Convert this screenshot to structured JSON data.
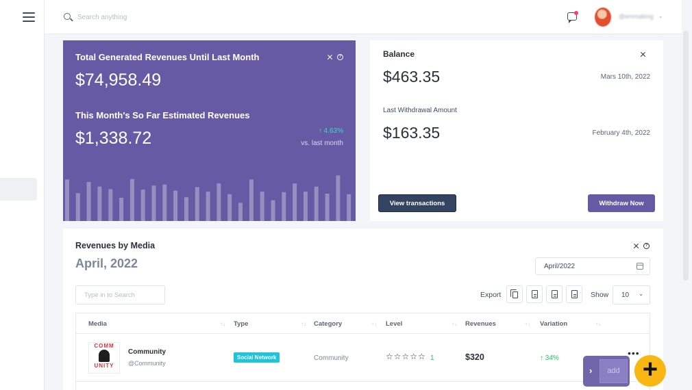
{
  "header": {
    "search_placeholder": "Search anything",
    "username": "@emmaking",
    "notification_color": "#ff3b6b"
  },
  "revenue_card": {
    "title": "Total Generated Revenues Until Last Month",
    "amount": "$74,958.49",
    "subtitle": "This Month's So Far Estimated Revenues",
    "amount_month": "$1,338.72",
    "growth": "↑ 4.63%",
    "growth_caption": "vs. last month",
    "bar_heights": [
      0.82,
      0.55,
      0.77,
      0.68,
      0.63,
      0.46,
      0.83,
      0.62,
      0.7,
      0.72,
      0.6,
      0.47,
      0.67,
      0.58,
      0.74,
      0.53,
      0.36,
      0.82,
      0.58,
      0.41,
      0.57,
      0.74,
      0.58,
      0.68,
      0.54,
      0.9,
      0.53
    ],
    "accent_color": "#655aa3"
  },
  "balance_card": {
    "title": "Balance",
    "amount": "$463.35",
    "date": "Mars 10th, 2022",
    "withdrawal_label": "Last Withdrawal Amount",
    "withdrawal_amount": "$163.35",
    "withdrawal_date": "February 4th, 2022",
    "view_button": "View transactions",
    "withdraw_button": "Withdraw Now"
  },
  "media_card": {
    "title": "Revenues by Media",
    "month": "April, 2022",
    "date_value": "April/2022",
    "search_placeholder": "Type in to Search",
    "export_label": "Export",
    "show_label": "Show",
    "show_value": "10",
    "columns": [
      "Media",
      "Type",
      "Category",
      "Level",
      "Revenues",
      "Variation"
    ],
    "rows": [
      {
        "thumb_text_top": "COMM",
        "thumb_text_bottom": "UNITY",
        "name": "Community",
        "handle": "@Community",
        "type": "Social Network",
        "category": "Community",
        "stars": "☆☆☆☆☆",
        "level": "1",
        "revenue": "$320",
        "variation": "↑ 34%"
      }
    ]
  },
  "fab": {
    "add_label": "add",
    "plus": "+"
  }
}
